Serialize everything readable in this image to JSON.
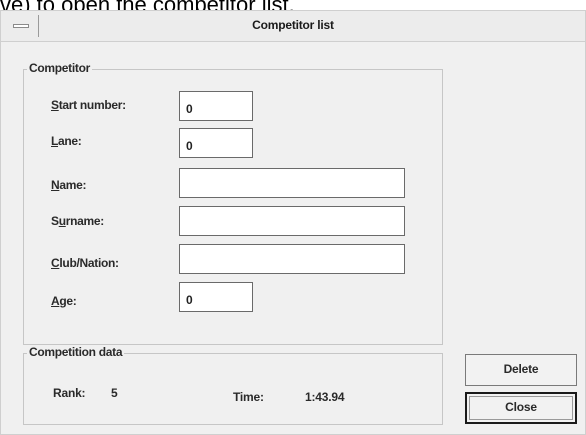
{
  "caption": "ve) to open the competitor list.",
  "window": {
    "title": "Competitor list"
  },
  "competitor_group": {
    "label": "Competitor",
    "start_number_label_u": "S",
    "start_number_label_rest": "tart number:",
    "start_number_value": "0",
    "lane_label_u": "L",
    "lane_label_rest": "ane:",
    "lane_value": "0",
    "name_label_u": "N",
    "name_label_rest": "ame:",
    "name_value": "",
    "surname_label_pre": "S",
    "surname_label_u": "u",
    "surname_label_rest": "rname:",
    "surname_value": "",
    "club_label_u": "C",
    "club_label_rest": "lub/Nation:",
    "club_value": "",
    "age_label_u": "A",
    "age_label_rest": "ge:",
    "age_value": "0"
  },
  "competition_group": {
    "label": "Competition data",
    "rank_label": "Rank:",
    "rank_value": "5",
    "time_label": "Time:",
    "time_value": "1:43.94"
  },
  "buttons": {
    "delete": "Delete",
    "close": "Close"
  }
}
